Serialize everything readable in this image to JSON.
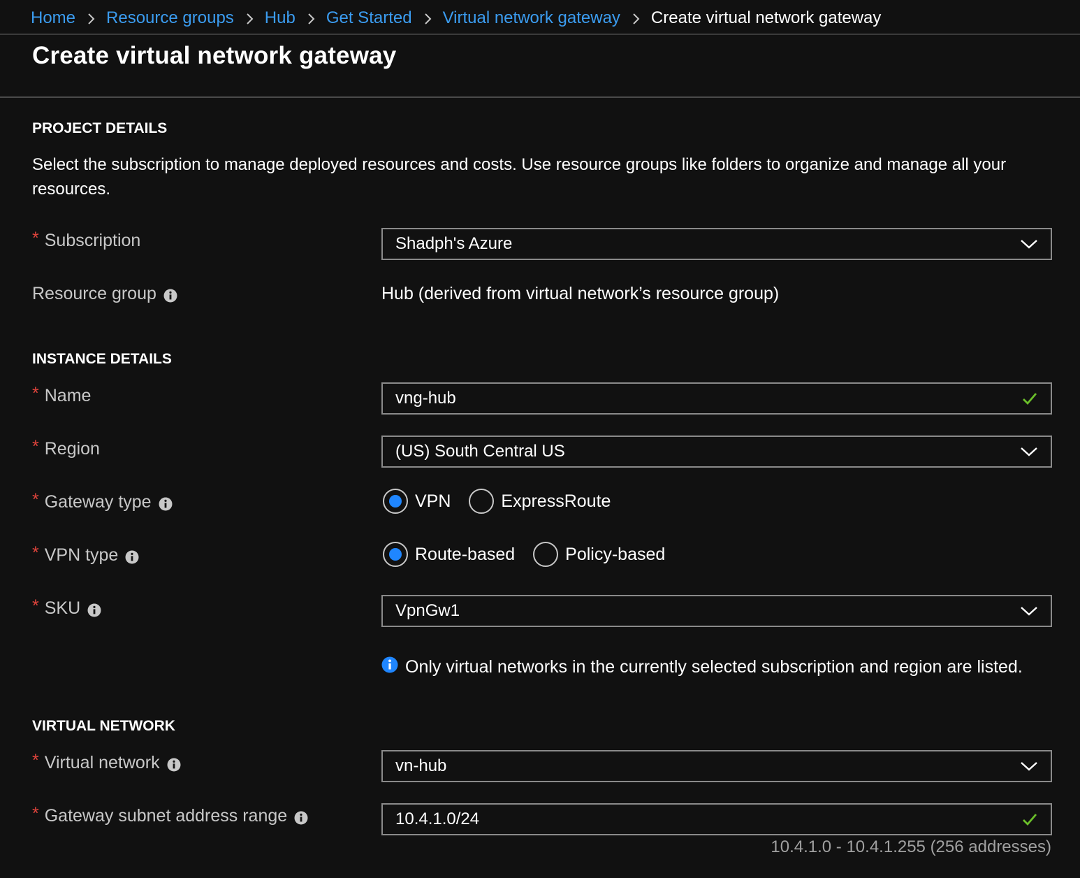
{
  "breadcrumb": {
    "items": [
      "Home",
      "Resource groups",
      "Hub",
      "Get Started",
      "Virtual network gateway"
    ],
    "current": "Create virtual network gateway"
  },
  "page": {
    "title": "Create virtual network gateway"
  },
  "project_details": {
    "heading": "PROJECT DETAILS",
    "description": "Select the subscription to manage deployed resources and costs. Use resource groups like folders to organize and manage all your resources.",
    "subscription": {
      "required_mark": "*",
      "label": "Subscription",
      "value": "Shadph's Azure"
    },
    "resource_group": {
      "label": "Resource group",
      "value": "Hub (derived from virtual network’s resource group)"
    }
  },
  "instance_details": {
    "heading": "INSTANCE DETAILS",
    "name": {
      "required_mark": "*",
      "label": "Name",
      "value": "vng-hub"
    },
    "region": {
      "required_mark": "*",
      "label": "Region",
      "value": "(US) South Central US"
    },
    "gateway_type": {
      "required_mark": "*",
      "label": "Gateway type",
      "options": [
        "VPN",
        "ExpressRoute"
      ],
      "selected": "VPN"
    },
    "vpn_type": {
      "required_mark": "*",
      "label": "VPN type",
      "options": [
        "Route-based",
        "Policy-based"
      ],
      "selected": "Route-based"
    },
    "sku": {
      "required_mark": "*",
      "label": "SKU",
      "value": "VpnGw1"
    },
    "note": "Only virtual networks in the currently selected subscription and region are listed."
  },
  "virtual_network": {
    "heading": "VIRTUAL NETWORK",
    "virtual_network": {
      "required_mark": "*",
      "label": "Virtual network",
      "value": "vn-hub"
    },
    "gateway_subnet": {
      "required_mark": "*",
      "label": "Gateway subnet address range",
      "value": "10.4.1.0/24",
      "hint": "10.4.1.0 - 10.4.1.255 (256 addresses)"
    }
  },
  "icons": {
    "info": "info-icon",
    "chevron": "chevron-down-icon",
    "check": "checkmark-icon",
    "breadcrumb_separator": "chevron-right-icon"
  },
  "colors": {
    "background": "#111111",
    "link": "#3b9cf0",
    "required": "#e0443c",
    "radio_selected": "#1f86ff",
    "valid_check": "#6bbf2a",
    "info_blue": "#1f86ff"
  }
}
